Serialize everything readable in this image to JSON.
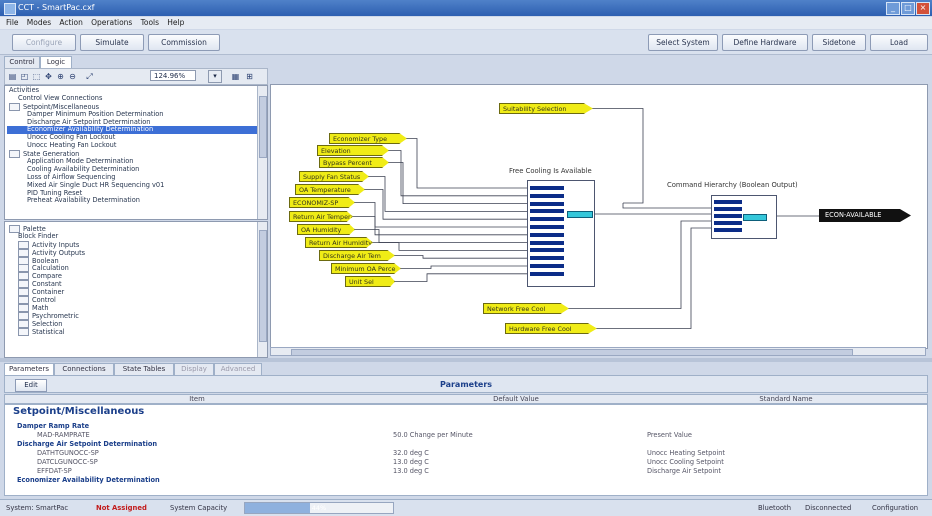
{
  "window": {
    "title": "CCT - SmartPac.cxf"
  },
  "menu": [
    "File",
    "Modes",
    "Action",
    "Operations",
    "Tools",
    "Help"
  ],
  "toolbar": {
    "configure": "Configure",
    "simulate": "Simulate",
    "commission": "Commission",
    "select_system": "Select System",
    "define_hardware": "Define Hardware",
    "sidetone": "Sidetone",
    "load": "Load"
  },
  "view_tabs": [
    "Control",
    "Logic"
  ],
  "zoom": {
    "value": "124.96%"
  },
  "activities": [
    {
      "label": "Activities",
      "indent": 0,
      "fold": false,
      "sel": false
    },
    {
      "label": "Control View Connections",
      "indent": 1,
      "fold": false,
      "sel": false
    },
    {
      "label": "Setpoint/Miscellaneous",
      "indent": 0,
      "fold": true,
      "sel": false
    },
    {
      "label": "Damper Minimum Position Determination",
      "indent": 2,
      "fold": false,
      "sel": false
    },
    {
      "label": "Discharge Air Setpoint Determination",
      "indent": 2,
      "fold": false,
      "sel": false
    },
    {
      "label": "Economizer Availability Determination",
      "indent": 2,
      "fold": false,
      "sel": true
    },
    {
      "label": "Unocc Cooling Fan Lockout",
      "indent": 2,
      "fold": false,
      "sel": false
    },
    {
      "label": "Unocc Heating Fan Lockout",
      "indent": 2,
      "fold": false,
      "sel": false
    },
    {
      "label": "State Generation",
      "indent": 0,
      "fold": true,
      "sel": false
    },
    {
      "label": "Application Mode Determination",
      "indent": 2,
      "fold": false,
      "sel": false
    },
    {
      "label": "Cooling Availability Determination",
      "indent": 2,
      "fold": false,
      "sel": false
    },
    {
      "label": "Loss of Airflow Sequencing",
      "indent": 2,
      "fold": false,
      "sel": false
    },
    {
      "label": "Mixed Air Single Duct HR Sequencing v01",
      "indent": 2,
      "fold": false,
      "sel": false
    },
    {
      "label": "PID Tuning Reset",
      "indent": 2,
      "fold": false,
      "sel": false
    },
    {
      "label": "Preheat Availability Determination",
      "indent": 2,
      "fold": false,
      "sel": false
    }
  ],
  "palette": [
    {
      "label": "Palette",
      "indent": 0,
      "fold": true
    },
    {
      "label": "Block Finder",
      "indent": 1,
      "fold": false
    },
    {
      "label": "Activity Inputs",
      "indent": 1,
      "fold": true
    },
    {
      "label": "Activity Outputs",
      "indent": 1,
      "fold": true
    },
    {
      "label": "Boolean",
      "indent": 1,
      "fold": true
    },
    {
      "label": "Calculation",
      "indent": 1,
      "fold": true
    },
    {
      "label": "Compare",
      "indent": 1,
      "fold": true
    },
    {
      "label": "Constant",
      "indent": 1,
      "fold": true
    },
    {
      "label": "Container",
      "indent": 1,
      "fold": true
    },
    {
      "label": "Control",
      "indent": 1,
      "fold": true
    },
    {
      "label": "Math",
      "indent": 1,
      "fold": true
    },
    {
      "label": "Psychrometric",
      "indent": 1,
      "fold": true
    },
    {
      "label": "Selection",
      "indent": 1,
      "fold": true
    },
    {
      "label": "Statistical",
      "indent": 1,
      "fold": true
    }
  ],
  "diagram": {
    "inputs_left": [
      "Economizer Type",
      "Elevation",
      "Bypass Percent",
      "Supply Fan Status",
      "OA Temperature",
      "ECONOMIZ-SP",
      "Return Air Tempera",
      "OA Humidity",
      "Return Air Humidity",
      "Discharge Air Tem",
      "Minimum OA Perce",
      "Unit Sel"
    ],
    "input_top": "Suitability Selection",
    "inputs_bottom": [
      "Network Free Cool",
      "Hardware Free Cool"
    ],
    "block1_title": "Free Cooling Is Available",
    "block2_title": "Command Hierarchy (Boolean Output)",
    "output": "ECON-AVAILABLE"
  },
  "param_tabs": [
    "Parameters",
    "Connections",
    "State Tables",
    "Display",
    "Advanced"
  ],
  "parameters": {
    "title": "Parameters",
    "edit": "Edit",
    "columns": [
      "Item",
      "Default Value",
      "Standard Name"
    ],
    "group": "Setpoint/Miscellaneous",
    "rows": [
      {
        "kind": "sub",
        "item": "Damper Ramp Rate",
        "value": "",
        "std": ""
      },
      {
        "kind": "row",
        "item": "MAD-RAMPRATE",
        "value": "50.0 Change per Minute",
        "std": "Present Value"
      },
      {
        "kind": "sub",
        "item": "Discharge Air Setpoint Determination",
        "value": "",
        "std": ""
      },
      {
        "kind": "row",
        "item": "DATHTGUNOCC-SP",
        "value": "32.0 deg C",
        "std": "Unocc Heating Setpoint"
      },
      {
        "kind": "row",
        "item": "DATCLGUNOCC-SP",
        "value": "13.0 deg C",
        "std": "Unocc Cooling Setpoint"
      },
      {
        "kind": "row",
        "item": "EFFDAT-SP",
        "value": "13.0 deg C",
        "std": "Discharge Air Setpoint"
      },
      {
        "kind": "sub",
        "item": "Economizer Availability Determination",
        "value": "",
        "std": ""
      }
    ]
  },
  "status": {
    "system": "System: SmartPac",
    "assigned": "Not Assigned",
    "capacity_label": "System Capacity",
    "capacity_pct": "44%",
    "capacity_fraction": 0.44,
    "bluetooth": "Bluetooth",
    "connection": "Disconnected",
    "mode": "Configuration"
  }
}
